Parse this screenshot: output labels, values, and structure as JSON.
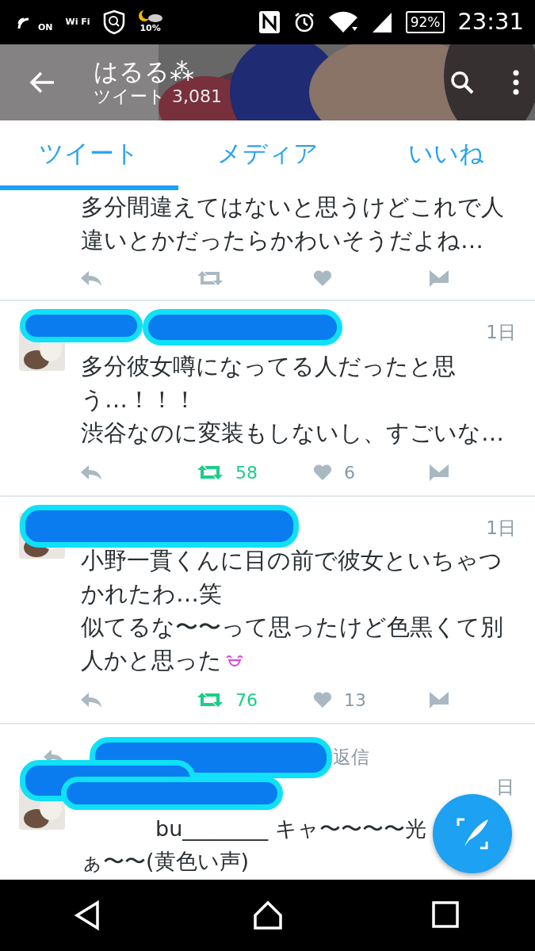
{
  "status_bar": {
    "labels": [
      "ON",
      "Wi Fi"
    ],
    "weather": "10%",
    "battery": "92%",
    "time": "23:31"
  },
  "header": {
    "title": "はるる⁂",
    "subtitle": "ツイート",
    "count": "3,081"
  },
  "tabs": [
    {
      "label": "ツイート",
      "selected": true
    },
    {
      "label": "メディア",
      "selected": false
    },
    {
      "label": "いいね",
      "selected": false
    }
  ],
  "tweets": [
    {
      "kind": "cut",
      "text": "多分間違えてはないと思うけどこれで人違いとかだったらかわいそうだよね…",
      "retweeted": false
    },
    {
      "kind": "full",
      "time": "1日",
      "paragraphs": [
        "多分彼女噂になってる人だったと思う…！！！",
        "渋谷なのに変装もしないし、すごいな…"
      ],
      "retweeted": true,
      "retweets": "58",
      "likes": "6"
    },
    {
      "kind": "full",
      "time": "1日",
      "paragraphs": [
        "小野一貫くんに目の前で彼女といちゃつかれたわ…笑",
        "似てるな〜〜って思ったけど色黒くて別人かと思った"
      ],
      "emoji": true,
      "retweeted": true,
      "retweets": "76",
      "likes": "13"
    },
    {
      "kind": "partial",
      "context": "返信",
      "time": "日",
      "lines": [
        "bu________ キャ〜〜〜〜光",
        "ぁ〜〜(黄色い声)"
      ]
    }
  ]
}
